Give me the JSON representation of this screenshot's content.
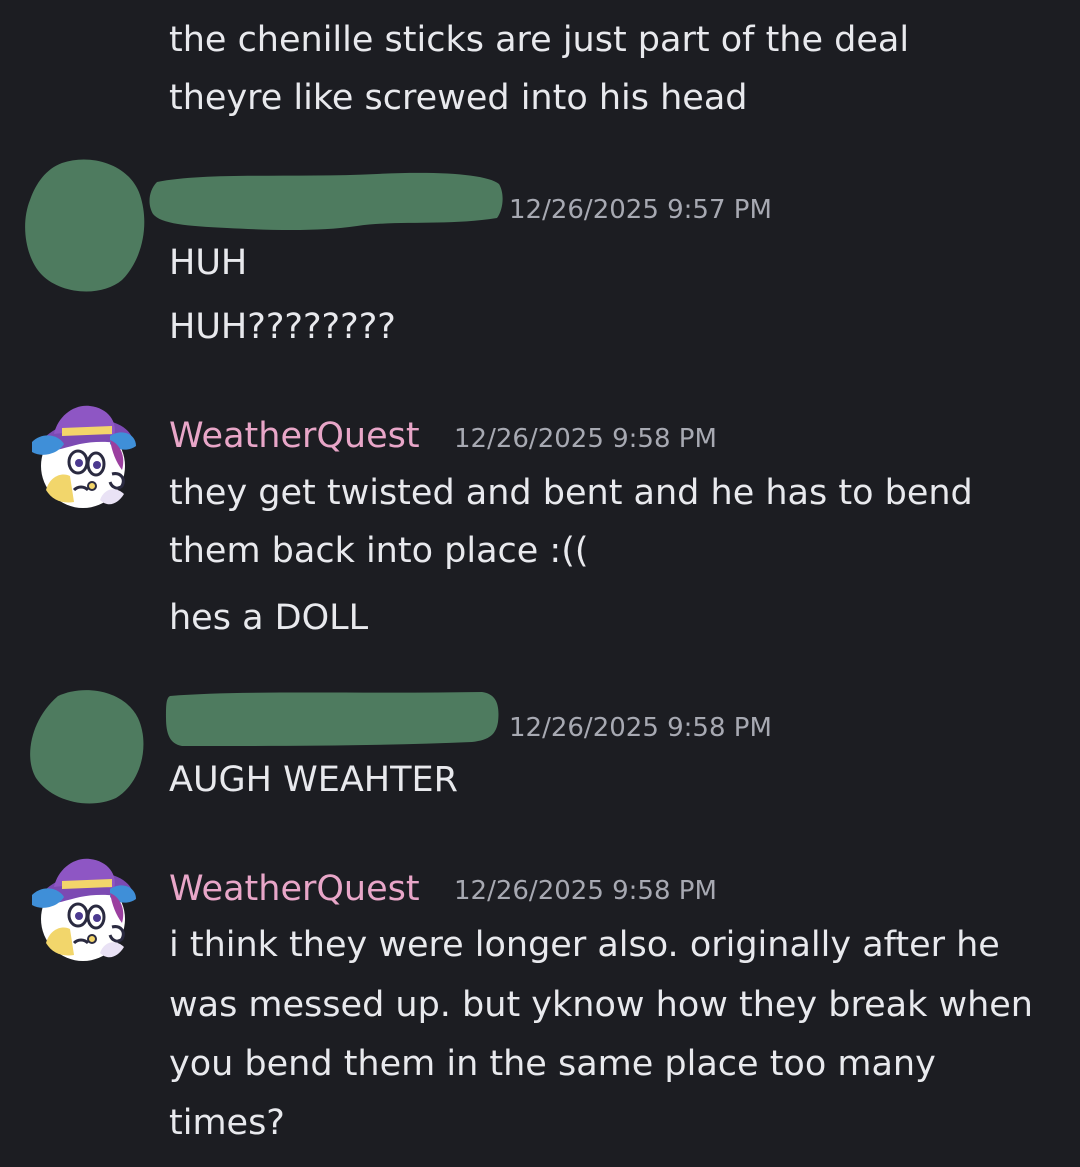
{
  "messages": [
    {
      "continuation": true,
      "lines": [
        "the chenille sticks are just part of the deal",
        "theyre like screwed into his head"
      ]
    },
    {
      "author": "",
      "author_redacted": true,
      "timestamp": "12/26/2025 9:57 PM",
      "lines": [
        "HUH",
        "HUH????????"
      ]
    },
    {
      "author": "WeatherQuest",
      "author_color": "#e8a6c8",
      "timestamp": "12/26/2025 9:58 PM",
      "lines": [
        "they get twisted and bent and he has to bend",
        "them back into place :((",
        "hes a DOLL"
      ]
    },
    {
      "author": "",
      "author_redacted": true,
      "timestamp": "12/26/2025 9:58 PM",
      "lines": [
        "AUGH WEAHTER"
      ]
    },
    {
      "author": "WeatherQuest",
      "author_color": "#e8a6c8",
      "timestamp": "12/26/2025 9:58 PM",
      "lines": [
        "i think they were longer also. originally after he",
        "was messed up. but yknow how they break when",
        "you bend them in the same place too many",
        "times?"
      ]
    }
  ],
  "colors": {
    "background": "#1c1d22",
    "text": "#e8e9ed",
    "timestamp": "#a7a9b2",
    "redaction": "#4e7b5f"
  },
  "icons": {
    "weatherquest_avatar": "avatar-witch-hat-character-icon",
    "redacted_avatar": "redacted-avatar-blob"
  }
}
